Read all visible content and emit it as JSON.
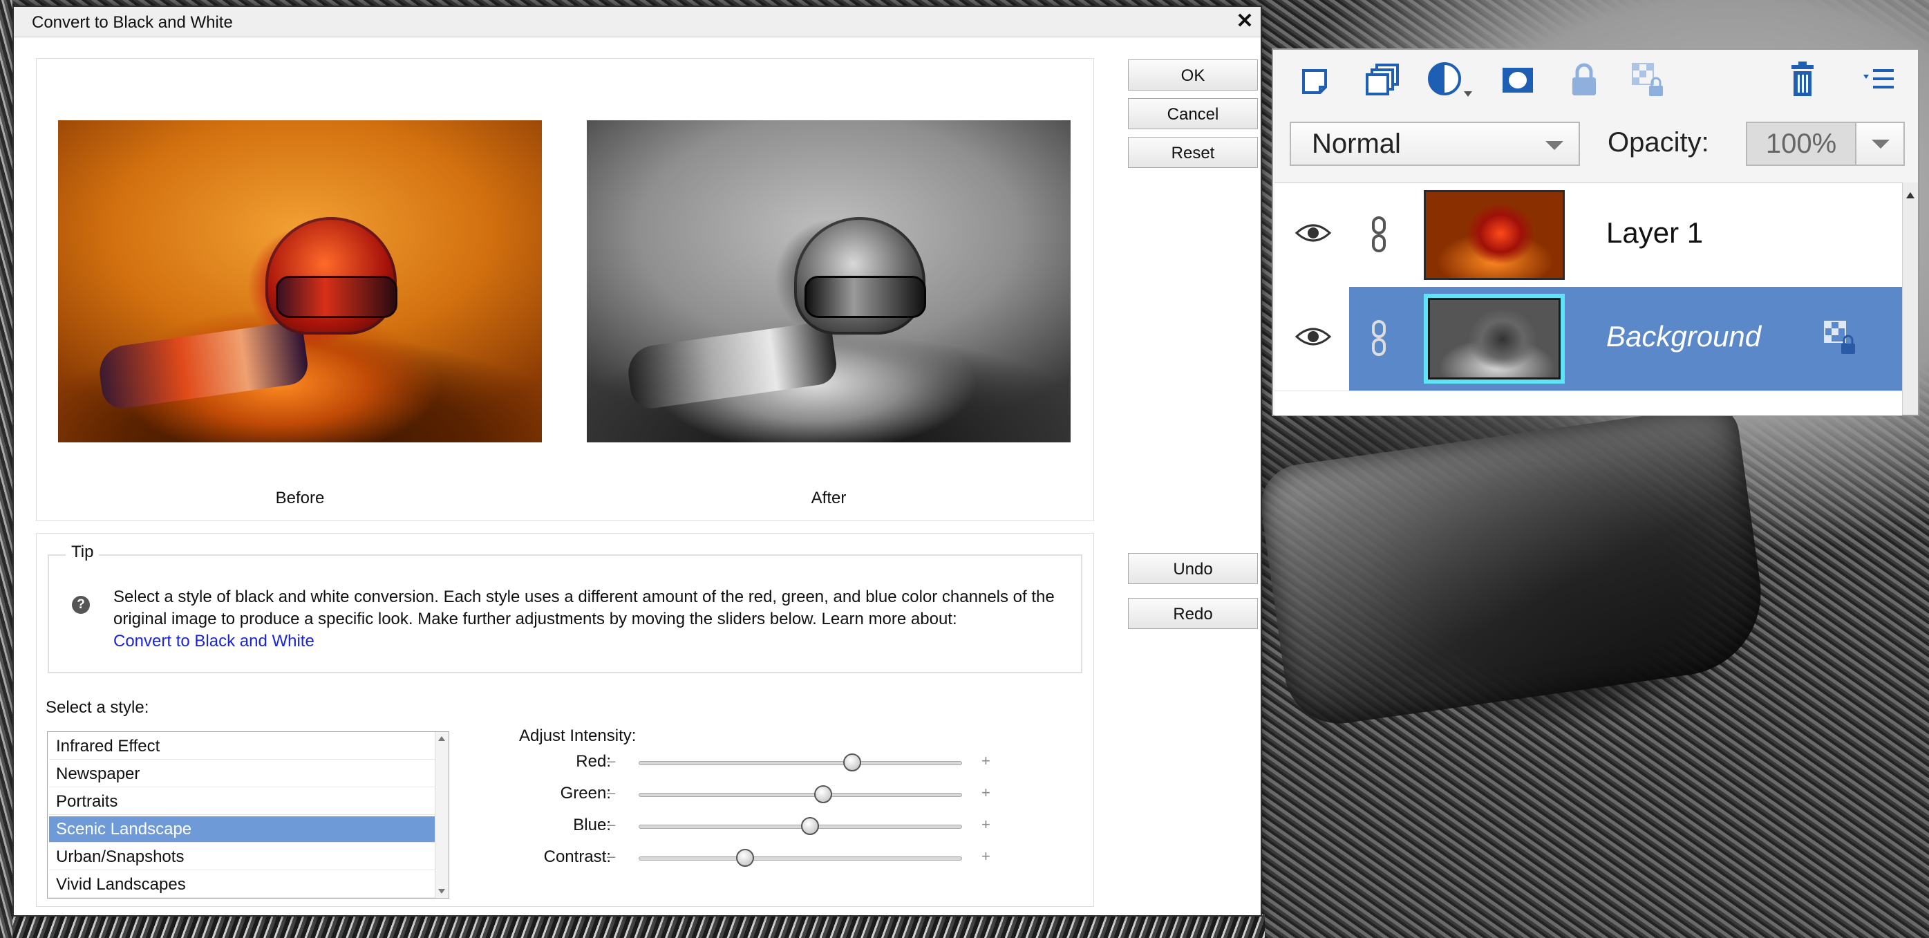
{
  "dialog": {
    "title": "Convert to Black and White",
    "close_glyph": "✕",
    "preview": {
      "before_label": "Before",
      "after_label": "After"
    },
    "buttons": {
      "ok": "OK",
      "cancel": "Cancel",
      "reset": "Reset",
      "undo": "Undo",
      "redo": "Redo"
    },
    "tip": {
      "legend": "Tip",
      "help_glyph": "?",
      "text": "Select a style of black and white conversion. Each style uses a different amount of the red, green, and blue color channels of the original image to produce a specific look. Make further adjustments by moving the sliders below. Learn more about:",
      "link": "Convert to Black and White"
    },
    "style_select": {
      "label": "Select a style:",
      "items": [
        "Infrared Effect",
        "Newspaper",
        "Portraits",
        "Scenic Landscape",
        "Urban/Snapshots",
        "Vivid Landscapes"
      ],
      "selected": "Scenic Landscape"
    },
    "intensity": {
      "label": "Adjust Intensity:",
      "minus": "–",
      "plus": "+",
      "sliders": [
        {
          "name": "Red:",
          "value": 0.66
        },
        {
          "name": "Green:",
          "value": 0.57
        },
        {
          "name": "Blue:",
          "value": 0.53
        },
        {
          "name": "Contrast:",
          "value": 0.33
        }
      ]
    }
  },
  "layers_panel": {
    "toolbar_icons": [
      "new-layer-icon",
      "new-group-icon",
      "adjustment-layer-icon",
      "layer-mask-icon",
      "lock-all-icon",
      "lock-transparency-icon",
      "delete-layer-icon",
      "panel-menu-icon"
    ],
    "blend_mode": "Normal",
    "opacity_label": "Opacity:",
    "opacity_value": "100%",
    "layers": [
      {
        "name": "Layer 1",
        "selected": false
      },
      {
        "name": "Background",
        "selected": true
      }
    ]
  },
  "colors": {
    "selection_blue": "#6f9ad8",
    "layer_selection_blue": "#5b88c9",
    "link_blue": "#1a24d8",
    "thumb_highlight": "#5ee3f7"
  }
}
